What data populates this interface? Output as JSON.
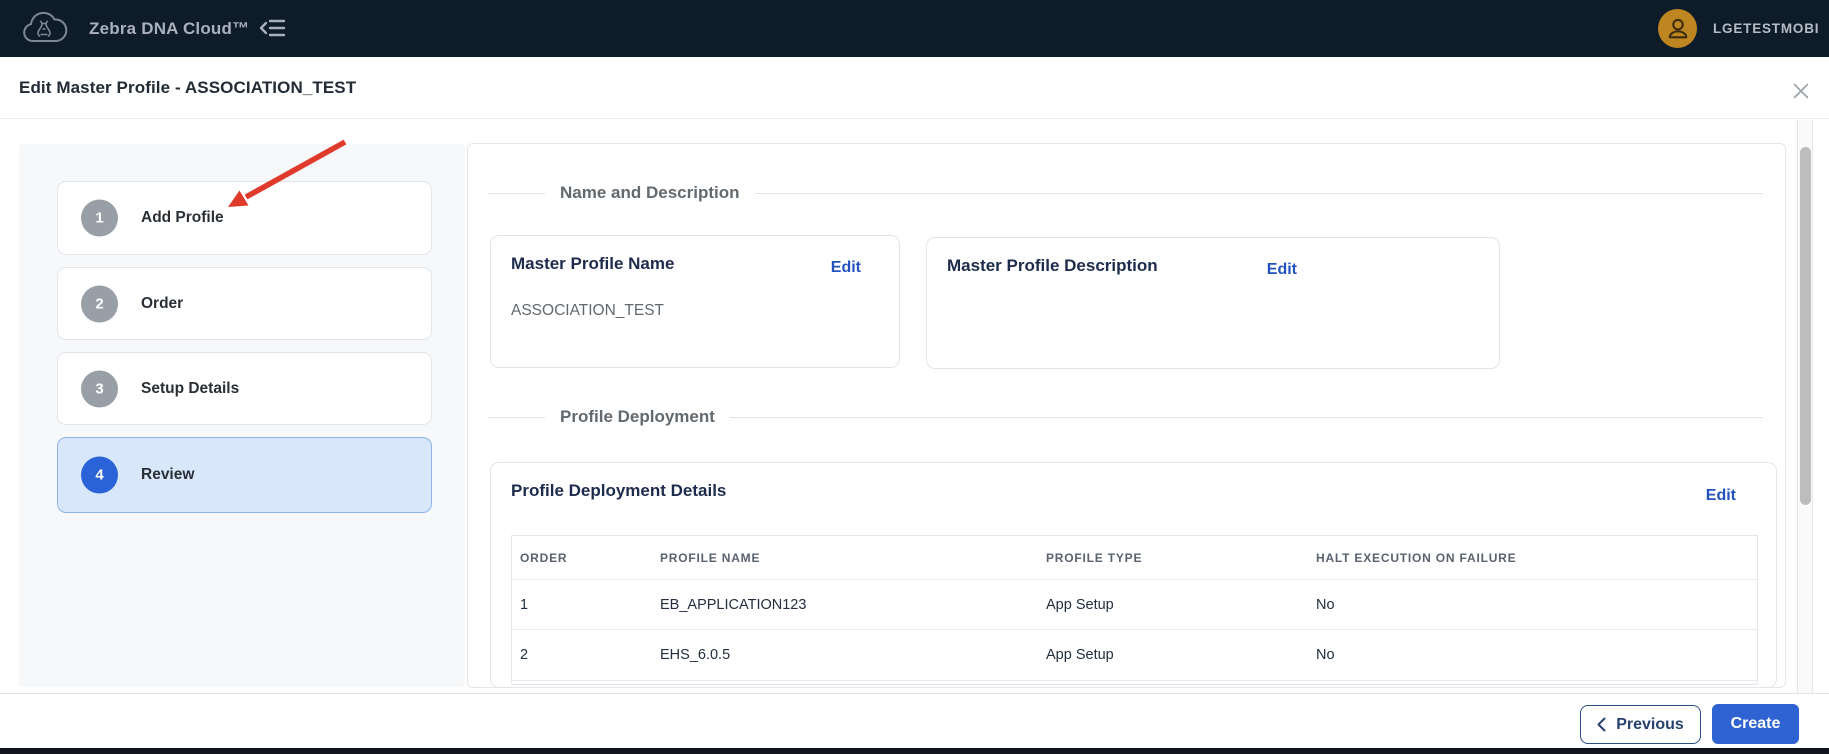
{
  "topbar": {
    "brand": "Zebra DNA Cloud™",
    "user": "LGETESTMOBI"
  },
  "dialog": {
    "title": "Edit Master Profile - ASSOCIATION_TEST"
  },
  "steps": [
    {
      "number": "1",
      "label": "Add Profile",
      "active": false
    },
    {
      "number": "2",
      "label": "Order",
      "active": false
    },
    {
      "number": "3",
      "label": "Setup Details",
      "active": false
    },
    {
      "number": "4",
      "label": "Review",
      "active": true
    }
  ],
  "sections": {
    "name_description": "Name and Description",
    "profile_deployment": "Profile Deployment"
  },
  "cards": {
    "master_profile_name": {
      "title": "Master Profile Name",
      "edit_label": "Edit",
      "value": "ASSOCIATION_TEST"
    },
    "master_profile_description": {
      "title": "Master Profile Description",
      "edit_label": "Edit"
    },
    "deployment": {
      "title": "Profile Deployment Details",
      "edit_label": "Edit"
    }
  },
  "deployment_table": {
    "columns": [
      "ORDER",
      "PROFILE NAME",
      "PROFILE TYPE",
      "HALT EXECUTION ON FAILURE"
    ],
    "rows": [
      {
        "order": "1",
        "profile_name": "EB_APPLICATION123",
        "profile_type": "App Setup",
        "halt": "No"
      },
      {
        "order": "2",
        "profile_name": "EHS_6.0.5",
        "profile_type": "App Setup",
        "halt": "No"
      }
    ]
  },
  "footer": {
    "previous_label": "Previous",
    "create_label": "Create"
  },
  "colors": {
    "topbar_bg": "#0e1b29",
    "accent_blue": "#2f63d2",
    "active_step_blue": "#2a63d8",
    "active_step_bg": "#d9e7fb",
    "link_blue": "#2453c0",
    "step_circle_gray": "#999fa6",
    "avatar_gold": "#bd8620",
    "arrow_red": "#e03a2c",
    "sidebar_bg": "#f6f8fa"
  }
}
